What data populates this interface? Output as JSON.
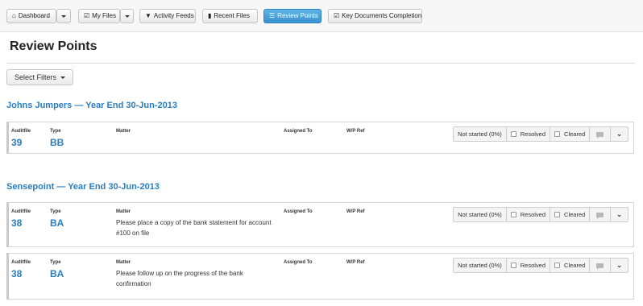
{
  "toolbar": {
    "dashboard": "Dashboard",
    "my_files": "My Files",
    "activity_feeds": "Activity Feeds",
    "recent_files": "Recent Files",
    "review_points": "Review Points",
    "key_documents": "Key Documents Completion"
  },
  "page": {
    "title": "Review Points"
  },
  "filters": {
    "label": "Select Filters"
  },
  "columns": {
    "auditfile": "Auditfile",
    "type": "Type",
    "matter": "Matter",
    "assigned_to": "Assigned To",
    "wp_ref": "W/P Ref"
  },
  "status": {
    "not_started": "Not started (0%)",
    "resolved": "Resolved",
    "cleared": "Cleared"
  },
  "sections": [
    {
      "title": "Johns Jumpers — Year End 30-Jun-2013",
      "items": [
        {
          "auditfile": "39",
          "type": "BB",
          "matter": ""
        }
      ]
    },
    {
      "title": "Sensepoint — Year End 30-Jun-2013",
      "items": [
        {
          "auditfile": "38",
          "type": "BA",
          "matter": "Please place a copy of the bank statement for account #100 on file"
        },
        {
          "auditfile": "38",
          "type": "BA",
          "matter": "Please follow up on the progress of the bank confirmation"
        }
      ]
    }
  ]
}
